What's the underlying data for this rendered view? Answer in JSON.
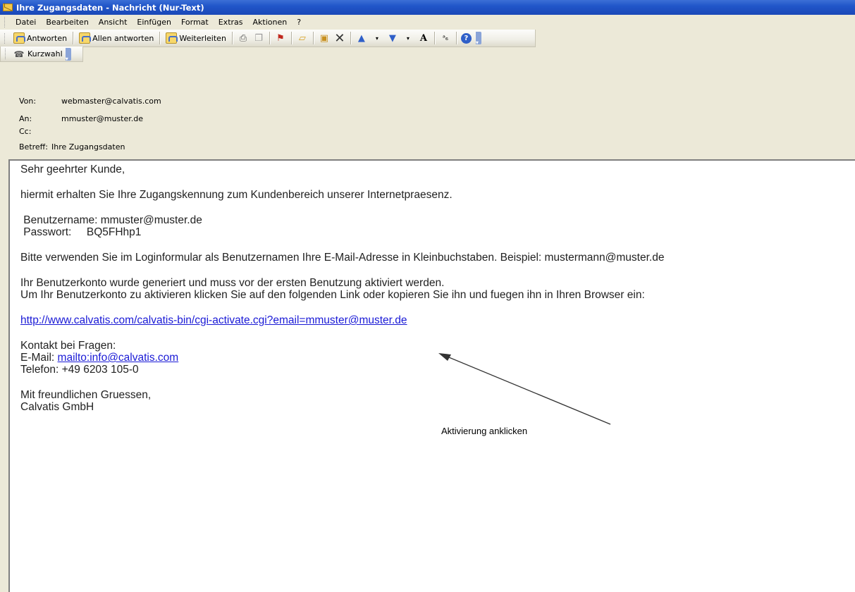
{
  "window": {
    "title": "Ihre Zugangsdaten - Nachricht (Nur-Text)"
  },
  "menu": [
    "Datei",
    "Bearbeiten",
    "Ansicht",
    "Einfügen",
    "Format",
    "Extras",
    "Aktionen",
    "?"
  ],
  "toolbar": {
    "reply_label": "Antworten",
    "reply_all_label": "Allen antworten",
    "forward_label": "Weiterleiten",
    "quickstep_label": "Kurzwahl",
    "format_glyph": "A",
    "help_glyph": "?"
  },
  "header": {
    "from_label": "Von:",
    "from_value": "webmaster@calvatis.com",
    "to_label": "An:",
    "to_value": "mmuster@muster.de",
    "cc_label": "Cc:",
    "cc_value": "",
    "subject_label": "Betreff:",
    "subject_value": "Ihre Zugangsdaten"
  },
  "body": {
    "greeting": "Sehr geehrter Kunde,",
    "intro": "hiermit erhalten Sie Ihre Zugangskennung zum Kundenbereich unserer Internetpraesenz.",
    "username_line": " Benutzername: mmuster@muster.de",
    "password_line": " Passwort:     BQ5FHhp1",
    "hint": "Bitte verwenden Sie im Loginformular als Benutzernamen Ihre E-Mail-Adresse in Kleinbuchstaben. Beispiel: mustermann@muster.de",
    "activation_1": "Ihr Benutzerkonto wurde generiert und muss vor der ersten Benutzung aktiviert werden.",
    "activation_2": "Um Ihr Benutzerkonto zu aktivieren klicken Sie auf den folgenden Link oder kopieren Sie ihn und fuegen ihn in Ihren Browser ein:",
    "activation_link": "http://www.calvatis.com/calvatis-bin/cgi-activate.cgi?email=mmuster@muster.de",
    "contact_heading": "Kontakt bei Fragen:",
    "email_prefix": "E-Mail: ",
    "email_link": "mailto:info@calvatis.com",
    "phone": "Telefon: +49 6203 105-0",
    "closing": "Mit freundlichen Gruessen,",
    "signature": "Calvatis GmbH"
  },
  "annotation": {
    "text": "Aktivierung anklicken"
  },
  "colors": {
    "titlebar": "#2156c9",
    "link": "#1a1ad6",
    "chrome": "#ece9d8"
  }
}
